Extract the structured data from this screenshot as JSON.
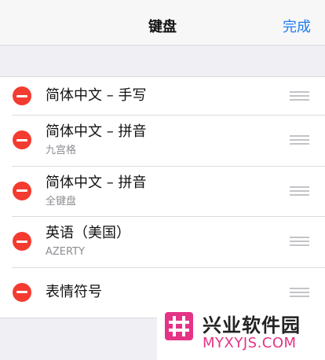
{
  "navbar": {
    "title": "键盘",
    "done_label": "完成"
  },
  "keyboards": [
    {
      "label": "简体中文 – 手写",
      "sublabel": ""
    },
    {
      "label": "简体中文 – 拼音",
      "sublabel": "九宫格"
    },
    {
      "label": "简体中文 – 拼音",
      "sublabel": "全键盘"
    },
    {
      "label": "英语（美国）",
      "sublabel": "AZERTY"
    },
    {
      "label": "表情符号",
      "sublabel": ""
    }
  ],
  "watermark": {
    "name": "兴业软件园",
    "url": "MYXYJS.COM",
    "logo_icon": "hash-logo-icon"
  },
  "colors": {
    "accent": "#1e7cf2",
    "delete": "#f33b30",
    "watermark_pink": "#e53386"
  }
}
